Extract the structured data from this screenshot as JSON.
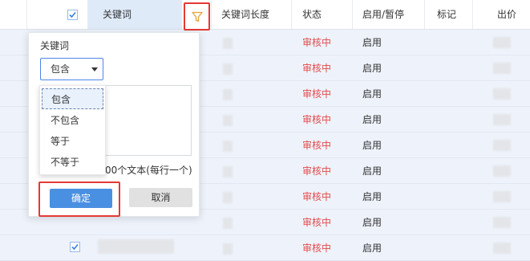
{
  "header": {
    "keyword": "关键词",
    "keyword_length": "关键词长度",
    "status": "状态",
    "enable_pause": "启用/暂停",
    "mark": "标记",
    "bid": "出价"
  },
  "rows": [
    {
      "status": "审核中",
      "enable": "启用"
    },
    {
      "status": "审核中",
      "enable": "启用"
    },
    {
      "status": "审核中",
      "enable": "启用"
    },
    {
      "status": "审核中",
      "enable": "启用"
    },
    {
      "status": "审核中",
      "enable": "启用"
    },
    {
      "status": "审核中",
      "enable": "启用"
    },
    {
      "status": "审核中",
      "enable": "启用"
    },
    {
      "status": "审核中",
      "enable": "启用"
    },
    {
      "status": "审核中",
      "enable": "启用"
    }
  ],
  "filter": {
    "title": "关键词",
    "selected": "包含",
    "options": [
      "包含",
      "不包含",
      "等于",
      "不等于"
    ],
    "hint": "00个文本(每行一个)",
    "ok_label": "确定",
    "cancel_label": "取消"
  }
}
